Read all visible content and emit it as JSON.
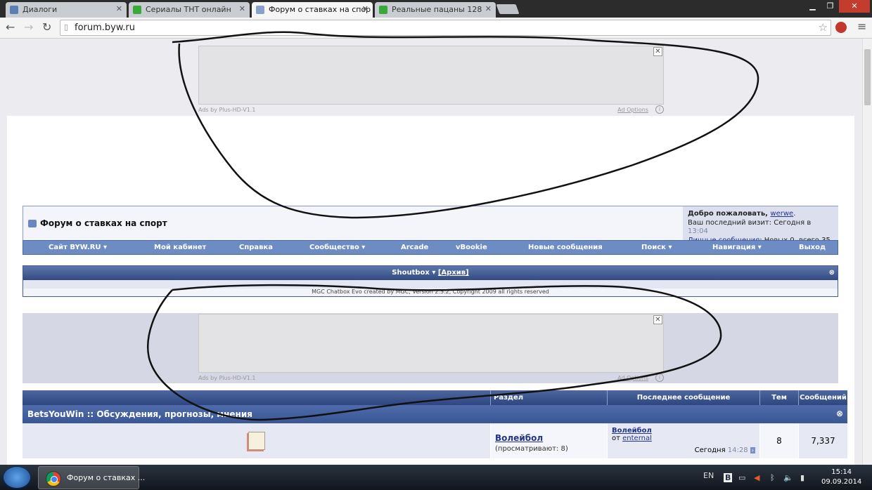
{
  "browser": {
    "tabs": [
      {
        "title": "Диалоги",
        "active": false
      },
      {
        "title": "Сериалы ТНТ онлайн",
        "active": false
      },
      {
        "title": "Форум о ставках на спор",
        "active": true
      },
      {
        "title": "Реальные пацаны 128",
        "active": false
      }
    ],
    "url": "forum.byw.ru"
  },
  "ads": {
    "label": "Ads by Plus-HD-V1.1",
    "options": "Ad Options",
    "close": "✕",
    "info": "i"
  },
  "forum": {
    "title": "Форум о ставках на спорт",
    "welcome": {
      "greeting": "Добро пожаловать, ",
      "user": "werwe",
      "last_visit_label": "Ваш последний визит: Сегодня в ",
      "last_visit_time": "13:04",
      "pm_link": "Личные сообщения",
      "pm_text": ": Новых 0, всего 35."
    },
    "nav": [
      "Сайт BYW.RU ▾",
      "Мой кабинет",
      "Справка",
      "Сообщество ▾",
      "Arcade",
      "vBookie",
      "Новые сообщения",
      "Поиск ▾",
      "Навигация ▾",
      "Выход"
    ],
    "shoutbox": {
      "title": "Shoutbox ▾",
      "archive": "[Архив]",
      "copyright": "MGC Chatbox Evo created by MGC, Version 2.3.2, Copyright 2009 all rights reserved"
    },
    "table": {
      "headers": {
        "section": "Раздел",
        "last_post": "Последнее сообщение",
        "threads": "Тем",
        "posts": "Сообщений"
      },
      "category": "BetsYouWin :: Обсуждения, прогнозы, мнения",
      "rows": [
        {
          "name": "Волейбол",
          "viewing": "(просматривают: 8)",
          "last_title": "Волейбол",
          "last_by_prefix": "от ",
          "last_by": "enternal",
          "last_date": "Сегодня ",
          "last_time": "14:28",
          "threads": "8",
          "posts": "7,337"
        }
      ]
    }
  },
  "taskbar": {
    "app": "Форум о ставках ...",
    "lang": "EN",
    "time": "15:14",
    "date": "09.09.2014"
  }
}
